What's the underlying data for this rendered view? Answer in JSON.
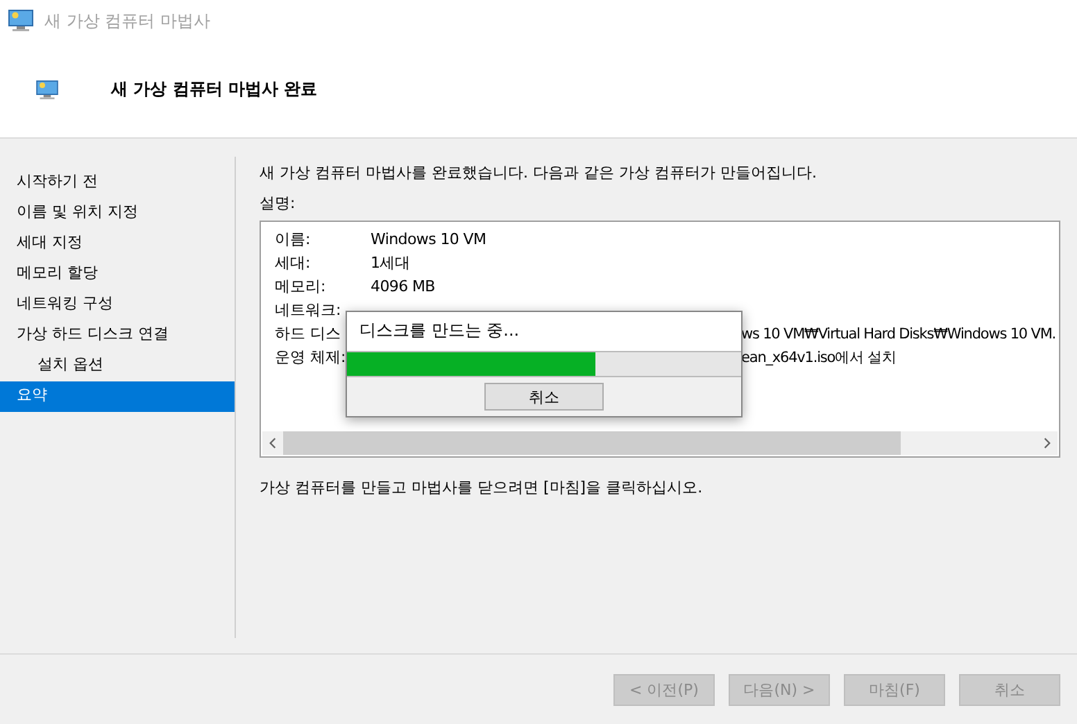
{
  "window": {
    "title": "새 가상 컴퓨터 마법사"
  },
  "header": {
    "title": "새 가상 컴퓨터 마법사 완료"
  },
  "sidebar": {
    "items": [
      {
        "label": "시작하기 전",
        "selected": false
      },
      {
        "label": "이름 및 위치 지정",
        "selected": false
      },
      {
        "label": "세대 지정",
        "selected": false
      },
      {
        "label": "메모리 할당",
        "selected": false
      },
      {
        "label": "네트워킹 구성",
        "selected": false
      },
      {
        "label": "가상 하드 디스크 연결",
        "selected": false,
        "children": [
          {
            "label": "설치 옵션",
            "selected": false
          }
        ]
      },
      {
        "label": "요약",
        "selected": true
      }
    ]
  },
  "content": {
    "intro": "새 가상 컴퓨터 마법사를 완료했습니다. 다음과 같은 가상 컴퓨터가 만들어집니다.",
    "description_label": "설명:",
    "summary_rows": [
      {
        "kind": "full",
        "label": "이름:",
        "value": "Windows 10 VM"
      },
      {
        "kind": "full",
        "label": "세대:",
        "value": "1세대"
      },
      {
        "kind": "full",
        "label": "메모리:",
        "value": "4096 MB"
      },
      {
        "kind": "covered",
        "label": "네트워크:"
      },
      {
        "kind": "covered",
        "label": "하드 디스",
        "value": "ws 10 VM₩Virtual Hard Disks₩Windows 10 VM."
      },
      {
        "kind": "covered",
        "label": "운영 체제:",
        "value": "ean_x64v1.iso에서 설치"
      }
    ],
    "footer_hint": "가상 컴퓨터를 만들고 마법사를 닫으려면 [마침]을 클릭하십시오."
  },
  "progress_dialog": {
    "message": "디스크를 만드는 중...",
    "level": 0.63,
    "cancel": "취소"
  },
  "buttons": [
    {
      "label": "< 이전(P)",
      "disabled": true
    },
    {
      "label": "다음(N) >",
      "disabled": true
    },
    {
      "label": "마침(F)",
      "disabled": true
    },
    {
      "label": "취소",
      "disabled": true
    }
  ]
}
